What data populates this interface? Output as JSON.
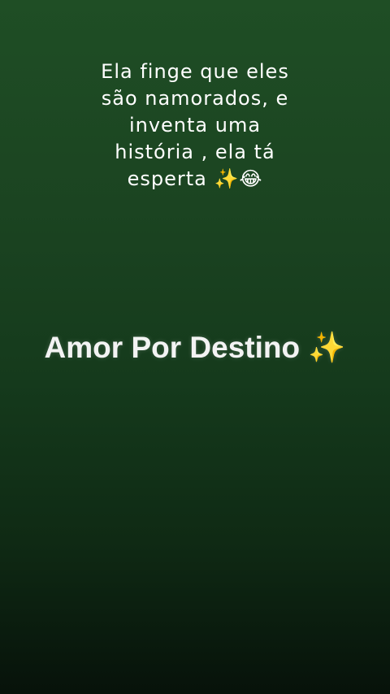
{
  "caption": {
    "lines": [
      "Ela finge que eles",
      "são namorados, e",
      "inventa uma",
      "história , ela tá",
      "esperta ✨😂"
    ]
  },
  "title": "Amor Por Destino ✨",
  "colors": {
    "background_top": "#1f4e25",
    "background_bottom": "#07120a",
    "text": "#ffffff"
  }
}
